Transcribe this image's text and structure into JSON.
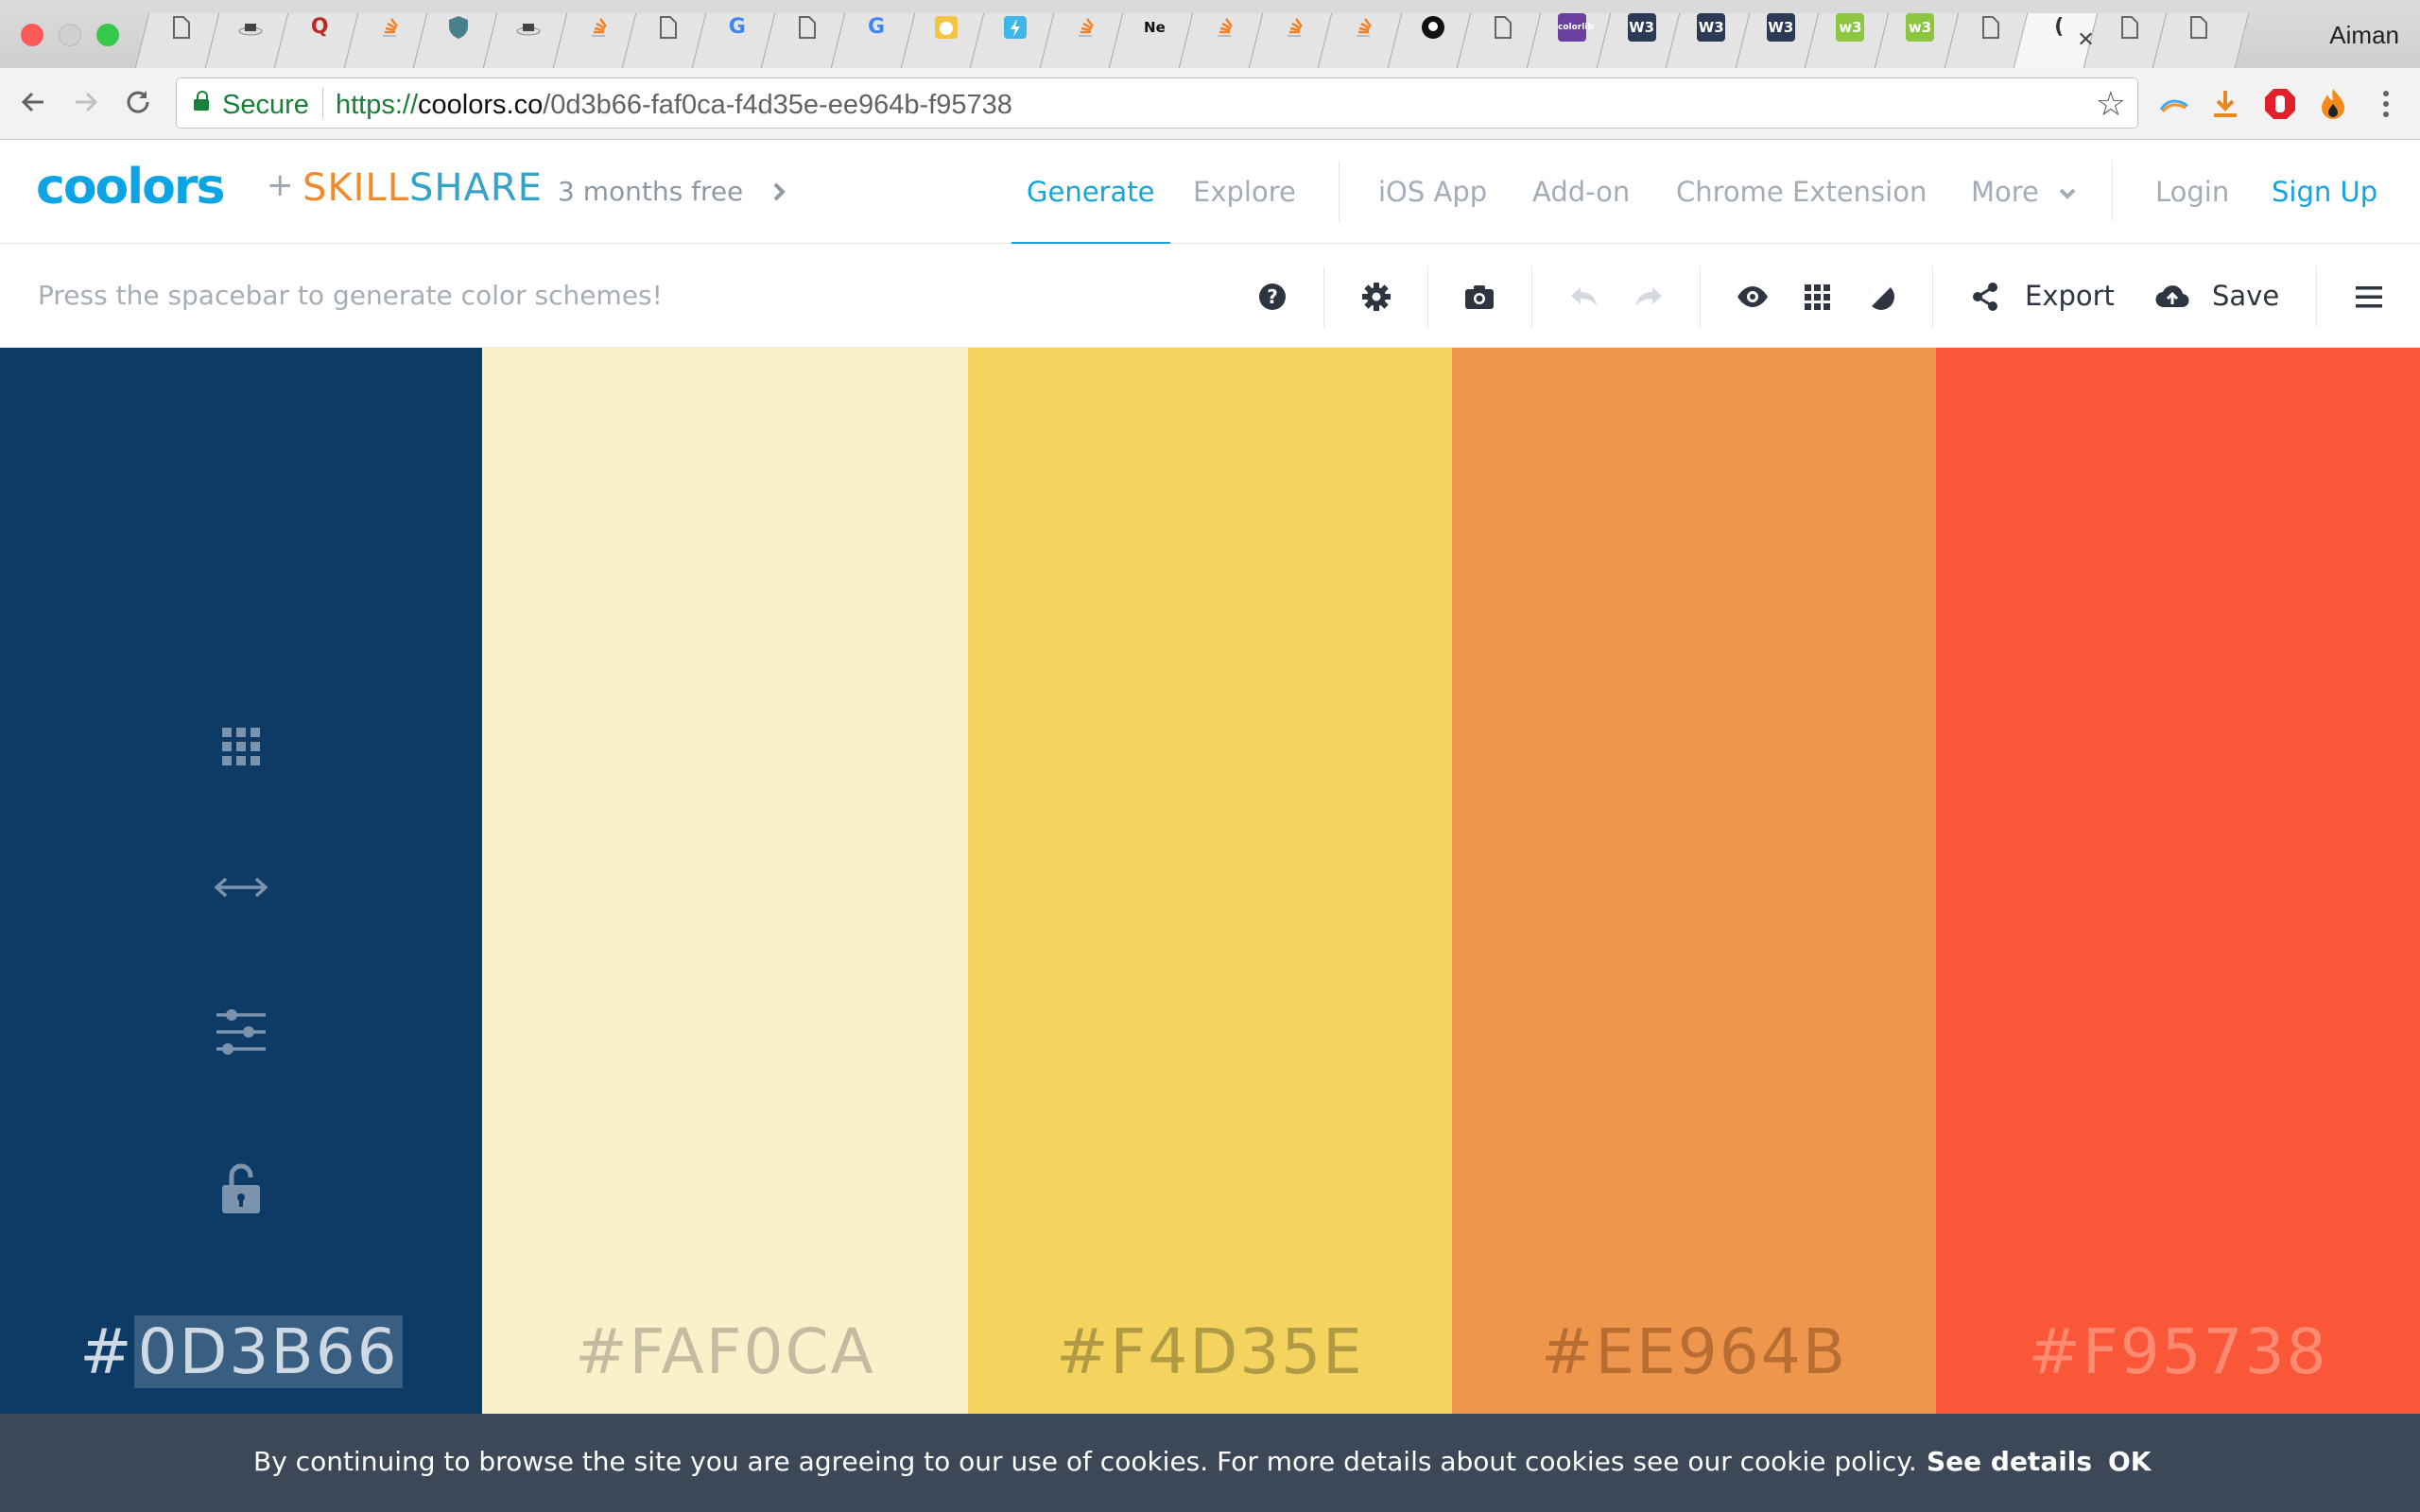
{
  "browser": {
    "profile_name": "Aiman",
    "tabs": [
      {
        "icon": "page-icon"
      },
      {
        "icon": "hat-icon"
      },
      {
        "icon": "quora-icon",
        "glyph": "Q"
      },
      {
        "icon": "stackoverflow-icon"
      },
      {
        "icon": "shield-icon"
      },
      {
        "icon": "hat-icon"
      },
      {
        "icon": "stackoverflow-icon"
      },
      {
        "icon": "page-icon"
      },
      {
        "icon": "google-icon",
        "glyph": "G"
      },
      {
        "icon": "page-icon"
      },
      {
        "icon": "google-icon",
        "glyph": "G"
      },
      {
        "icon": "cat-icon"
      },
      {
        "icon": "bolt-icon"
      },
      {
        "icon": "stackoverflow-icon"
      },
      {
        "icon": "text-tab",
        "glyph": "Ne"
      },
      {
        "icon": "stackoverflow-icon"
      },
      {
        "icon": "stackoverflow-icon"
      },
      {
        "icon": "stackoverflow-icon"
      },
      {
        "icon": "github-icon"
      },
      {
        "icon": "page-icon"
      },
      {
        "icon": "colorlib-icon",
        "glyph": "colorlib"
      },
      {
        "icon": "w3-icon",
        "glyph": "W3"
      },
      {
        "icon": "w3-icon",
        "glyph": "W3"
      },
      {
        "icon": "w3-icon",
        "glyph": "W3"
      },
      {
        "icon": "w3-green-icon",
        "glyph": "w3"
      },
      {
        "icon": "w3-green-icon",
        "glyph": "w3"
      },
      {
        "icon": "page-icon"
      },
      {
        "icon": "coolors-tab",
        "glyph": "(",
        "active": true
      },
      {
        "icon": "page-icon"
      },
      {
        "icon": "page-icon"
      }
    ],
    "secure_label": "Secure",
    "url_protocol": "https://",
    "url_host": "coolors.co",
    "url_path": "/0d3b66-faf0ca-f4d35e-ee964b-f95738"
  },
  "header": {
    "logo": "coolors",
    "plus": "+",
    "partner_a": "SKILL",
    "partner_b": "SHARE",
    "promo": "3 months free",
    "nav": {
      "generate": "Generate",
      "explore": "Explore",
      "ios_app": "iOS App",
      "add_on": "Add-on",
      "chrome_extension": "Chrome Extension",
      "more": "More",
      "login": "Login",
      "sign_up": "Sign Up"
    },
    "colors": {
      "accent": "#14a4de",
      "muted": "#a3adb7"
    }
  },
  "generator": {
    "hint": "Press the spacebar to generate color schemes!",
    "export_label": "Export",
    "save_label": "Save",
    "tools": [
      "help-icon",
      "settings-icon",
      "camera-icon",
      "undo-icon",
      "redo-icon",
      "eye-icon",
      "grid-icon",
      "contrast-icon",
      "share-icon",
      "cloud-upload-icon",
      "menu-icon"
    ]
  },
  "palette": {
    "swatches": [
      {
        "hex": "#0D3B66",
        "hash": "#",
        "code": "0D3B66",
        "text_color": "#cfd9e3",
        "selected": true
      },
      {
        "hex": "#FAF0CA",
        "hash": "#",
        "code": "FAF0CA",
        "text_color": "#c4bca0"
      },
      {
        "hex": "#F4D35E",
        "hash": "#",
        "code": "F4D35E",
        "text_color": "#b09b44"
      },
      {
        "hex": "#EE964B",
        "hash": "#",
        "code": "EE964B",
        "text_color": "#b86e33"
      },
      {
        "hex": "#F95738",
        "hash": "#",
        "code": "F95738",
        "text_color": "#ff8a72"
      }
    ],
    "swatch_tools": [
      "shades-icon",
      "drag-icon",
      "adjust-icon",
      "lock-icon"
    ]
  },
  "cookie": {
    "text": "By continuing to browse the site you are agreeing to our use of cookies. For more details about cookies see our cookie policy.",
    "details": "See details",
    "ok": "OK"
  }
}
